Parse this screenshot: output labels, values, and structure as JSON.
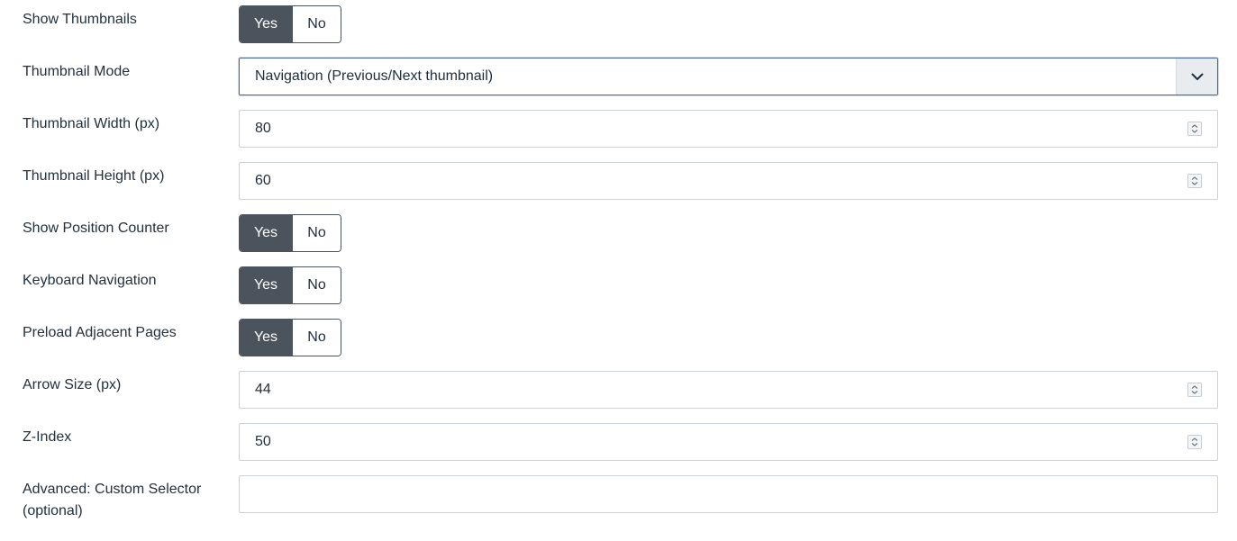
{
  "fields": {
    "show_thumbnails": {
      "label": "Show Thumbnails",
      "yes": "Yes",
      "no": "No",
      "selected": "Yes"
    },
    "thumbnail_mode": {
      "label": "Thumbnail Mode",
      "value": "Navigation (Previous/Next thumbnail)"
    },
    "thumbnail_width": {
      "label": "Thumbnail Width (px)",
      "value": "80"
    },
    "thumbnail_height": {
      "label": "Thumbnail Height (px)",
      "value": "60"
    },
    "show_position_counter": {
      "label": "Show Position Counter",
      "yes": "Yes",
      "no": "No",
      "selected": "Yes"
    },
    "keyboard_navigation": {
      "label": "Keyboard Navigation",
      "yes": "Yes",
      "no": "No",
      "selected": "Yes"
    },
    "preload_adjacent_pages": {
      "label": "Preload Adjacent Pages",
      "yes": "Yes",
      "no": "No",
      "selected": "Yes"
    },
    "arrow_size": {
      "label": "Arrow Size (px)",
      "value": "44"
    },
    "z_index": {
      "label": "Z-Index",
      "value": "50"
    },
    "custom_selector": {
      "label_line1": "Advanced: Custom Selector",
      "label_line2": "(optional)",
      "value": ""
    }
  },
  "colors": {
    "toggle_active_bg": "#4b545c",
    "select_border": "#4a6a9d",
    "input_border": "#c9d1d9"
  },
  "icons": {
    "select_caret": "chevron-down-icon",
    "number_spinner": "up-down-spinner-icon"
  }
}
